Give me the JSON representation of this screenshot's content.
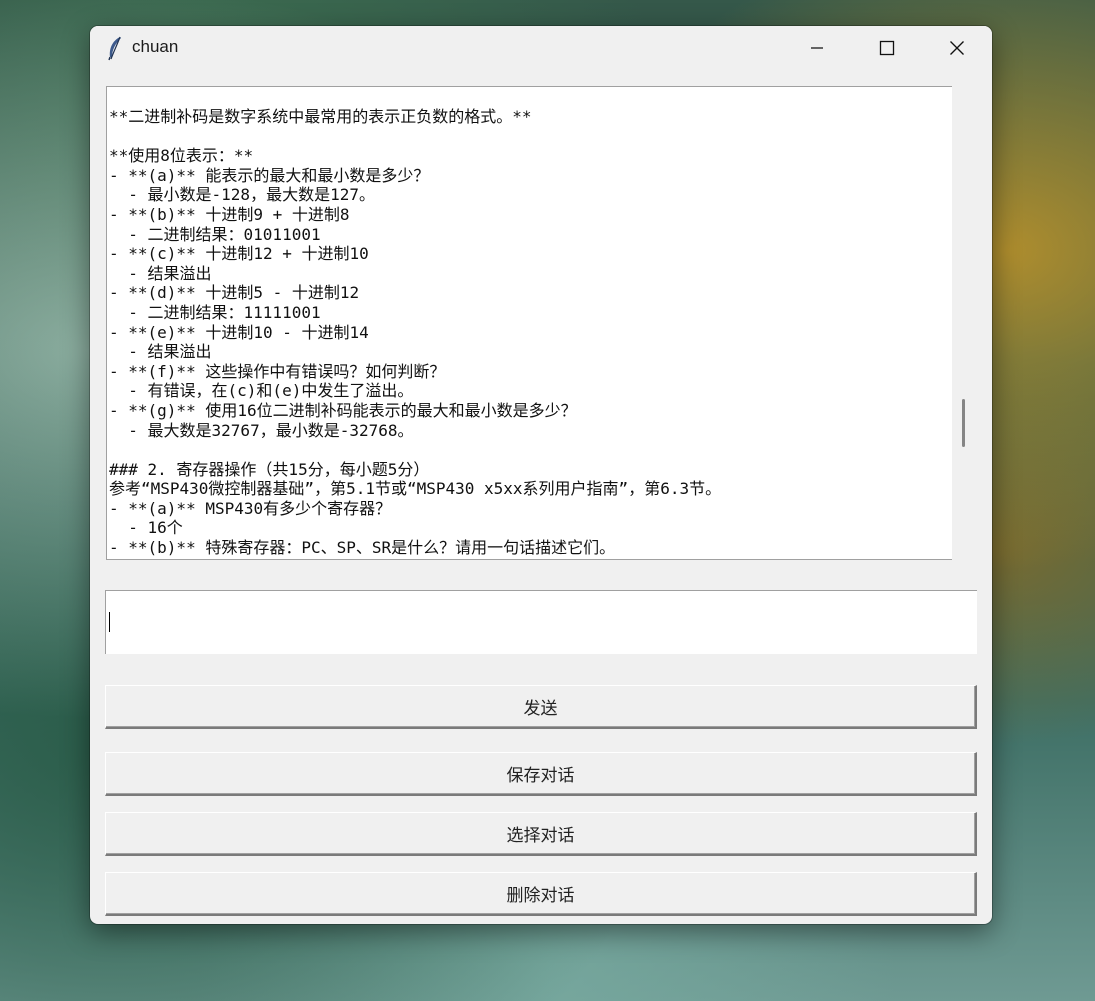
{
  "window": {
    "title": "chuan",
    "controls": {
      "minimize": "minimize-icon",
      "maximize": "maximize-icon",
      "close": "close-icon"
    }
  },
  "chat": {
    "lines": [
      "**二进制补码是数字系统中最常用的表示正负数的格式。**",
      "",
      "**使用8位表示：**",
      "- **(a)** 能表示的最大和最小数是多少？",
      "  - 最小数是-128，最大数是127。",
      "- **(b)** 十进制9 + 十进制8",
      "  - 二进制结果：01011001",
      "- **(c)** 十进制12 + 十进制10",
      "  - 结果溢出",
      "- **(d)** 十进制5 - 十进制12",
      "  - 二进制结果：11111001",
      "- **(e)** 十进制10 - 十进制14",
      "  - 结果溢出",
      "- **(f)** 这些操作中有错误吗？如何判断？",
      "  - 有错误，在(c)和(e)中发生了溢出。",
      "- **(g)** 使用16位二进制补码能表示的最大和最小数是多少？",
      "  - 最大数是32767，最小数是-32768。",
      "",
      "### 2. 寄存器操作（共15分，每小题5分）",
      "参考“MSP430微控制器基础”，第5.1节或“MSP430 x5xx系列用户指南”，第6.3节。",
      "- **(a)** MSP430有多少个寄存器？",
      "  - 16个",
      "- **(b)** 特殊寄存器：PC、SP、SR是什么？请用一句话描述它们。"
    ]
  },
  "input": {
    "value": ""
  },
  "buttons": {
    "send": "发送",
    "save": "保存对话",
    "select": "选择对话",
    "delete": "删除对话"
  }
}
